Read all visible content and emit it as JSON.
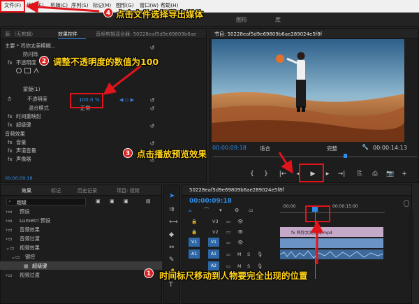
{
  "menubar": {
    "items": [
      {
        "label": "文件(F)"
      },
      {
        "label": "编辑(E)"
      },
      {
        "label": "剪辑(C)"
      },
      {
        "label": "序列(S)"
      },
      {
        "label": "标记(M)"
      },
      {
        "label": "图形(G)"
      },
      {
        "label": "窗口(W)"
      },
      {
        "label": "帮助(H)"
      }
    ]
  },
  "workspace": {
    "tabs": [
      {
        "label": "图形"
      },
      {
        "label": "库"
      }
    ]
  },
  "effect_controls": {
    "tabs": [
      {
        "label": "源:（无剪辑）"
      },
      {
        "label": "效果控件"
      },
      {
        "label": "音频剪辑混合器: 50228eaf5d9e69809b6ae"
      }
    ],
    "rows": {
      "master": "主要 * 鸡你太美模糊...",
      "anti_flicker": "防闪烁",
      "opacity_group": "不透明度",
      "mask": "蒙版(1)",
      "opacity": "不透明度",
      "opacity_value": "100.0 %",
      "blend_mode": "混合模式",
      "blend_value": "正常",
      "time_remap": "时间重映射",
      "super_key": "超级键",
      "audio_fx": "音频效果",
      "volume": "音量",
      "channel_volume": "声道音量",
      "panner": "声像器"
    },
    "timecode": "00:00:09:18"
  },
  "program_monitor": {
    "title": "节目: 50228eaf5d9e69809b6ae289024e5f8f",
    "timecode": "00:00:09:18",
    "fit": "适合",
    "quality": "完整",
    "duration": "00:00:14:13"
  },
  "effects_panel": {
    "tabs": [
      {
        "label": "效果"
      },
      {
        "label": "标记"
      },
      {
        "label": "历史记录"
      },
      {
        "label": "项目: 视频"
      }
    ],
    "search_value": "超级",
    "tree": [
      {
        "label": "预设"
      },
      {
        "label": "Lumetri 预设"
      },
      {
        "label": "音频效果"
      },
      {
        "label": "音频过渡"
      },
      {
        "label": "视频效果"
      },
      {
        "label": "键控"
      },
      {
        "label": "超级键"
      },
      {
        "label": "视频过渡"
      }
    ]
  },
  "timeline": {
    "title": "50228eaf5d9e69809b6ae289024e5f8f",
    "timecode": "00:00:09:18",
    "ruler_start": ":00:00",
    "ruler_mid": "00:00:15:00",
    "tracks": [
      {
        "label": "V3"
      },
      {
        "label": "V2"
      },
      {
        "label": "V1"
      },
      {
        "label": "A1"
      },
      {
        "label": "A2"
      }
    ],
    "clip_label": "fx 鸡你太美模糊.mp4"
  },
  "annotations": {
    "step1": {
      "num": "1",
      "text": "时间标尺移动到人物要完全出现的位置"
    },
    "step2": {
      "num": "2",
      "text": "调整不透明度的数值为100"
    },
    "step3": {
      "num": "3",
      "text": "点击播放预览效果"
    },
    "step4": {
      "num": "4",
      "text": "点击文件选择导出媒体"
    }
  },
  "colors": {
    "accent_blue": "#2d8ceb",
    "annotation_red": "#e1141b",
    "annotation_text": "#ffd21a"
  }
}
